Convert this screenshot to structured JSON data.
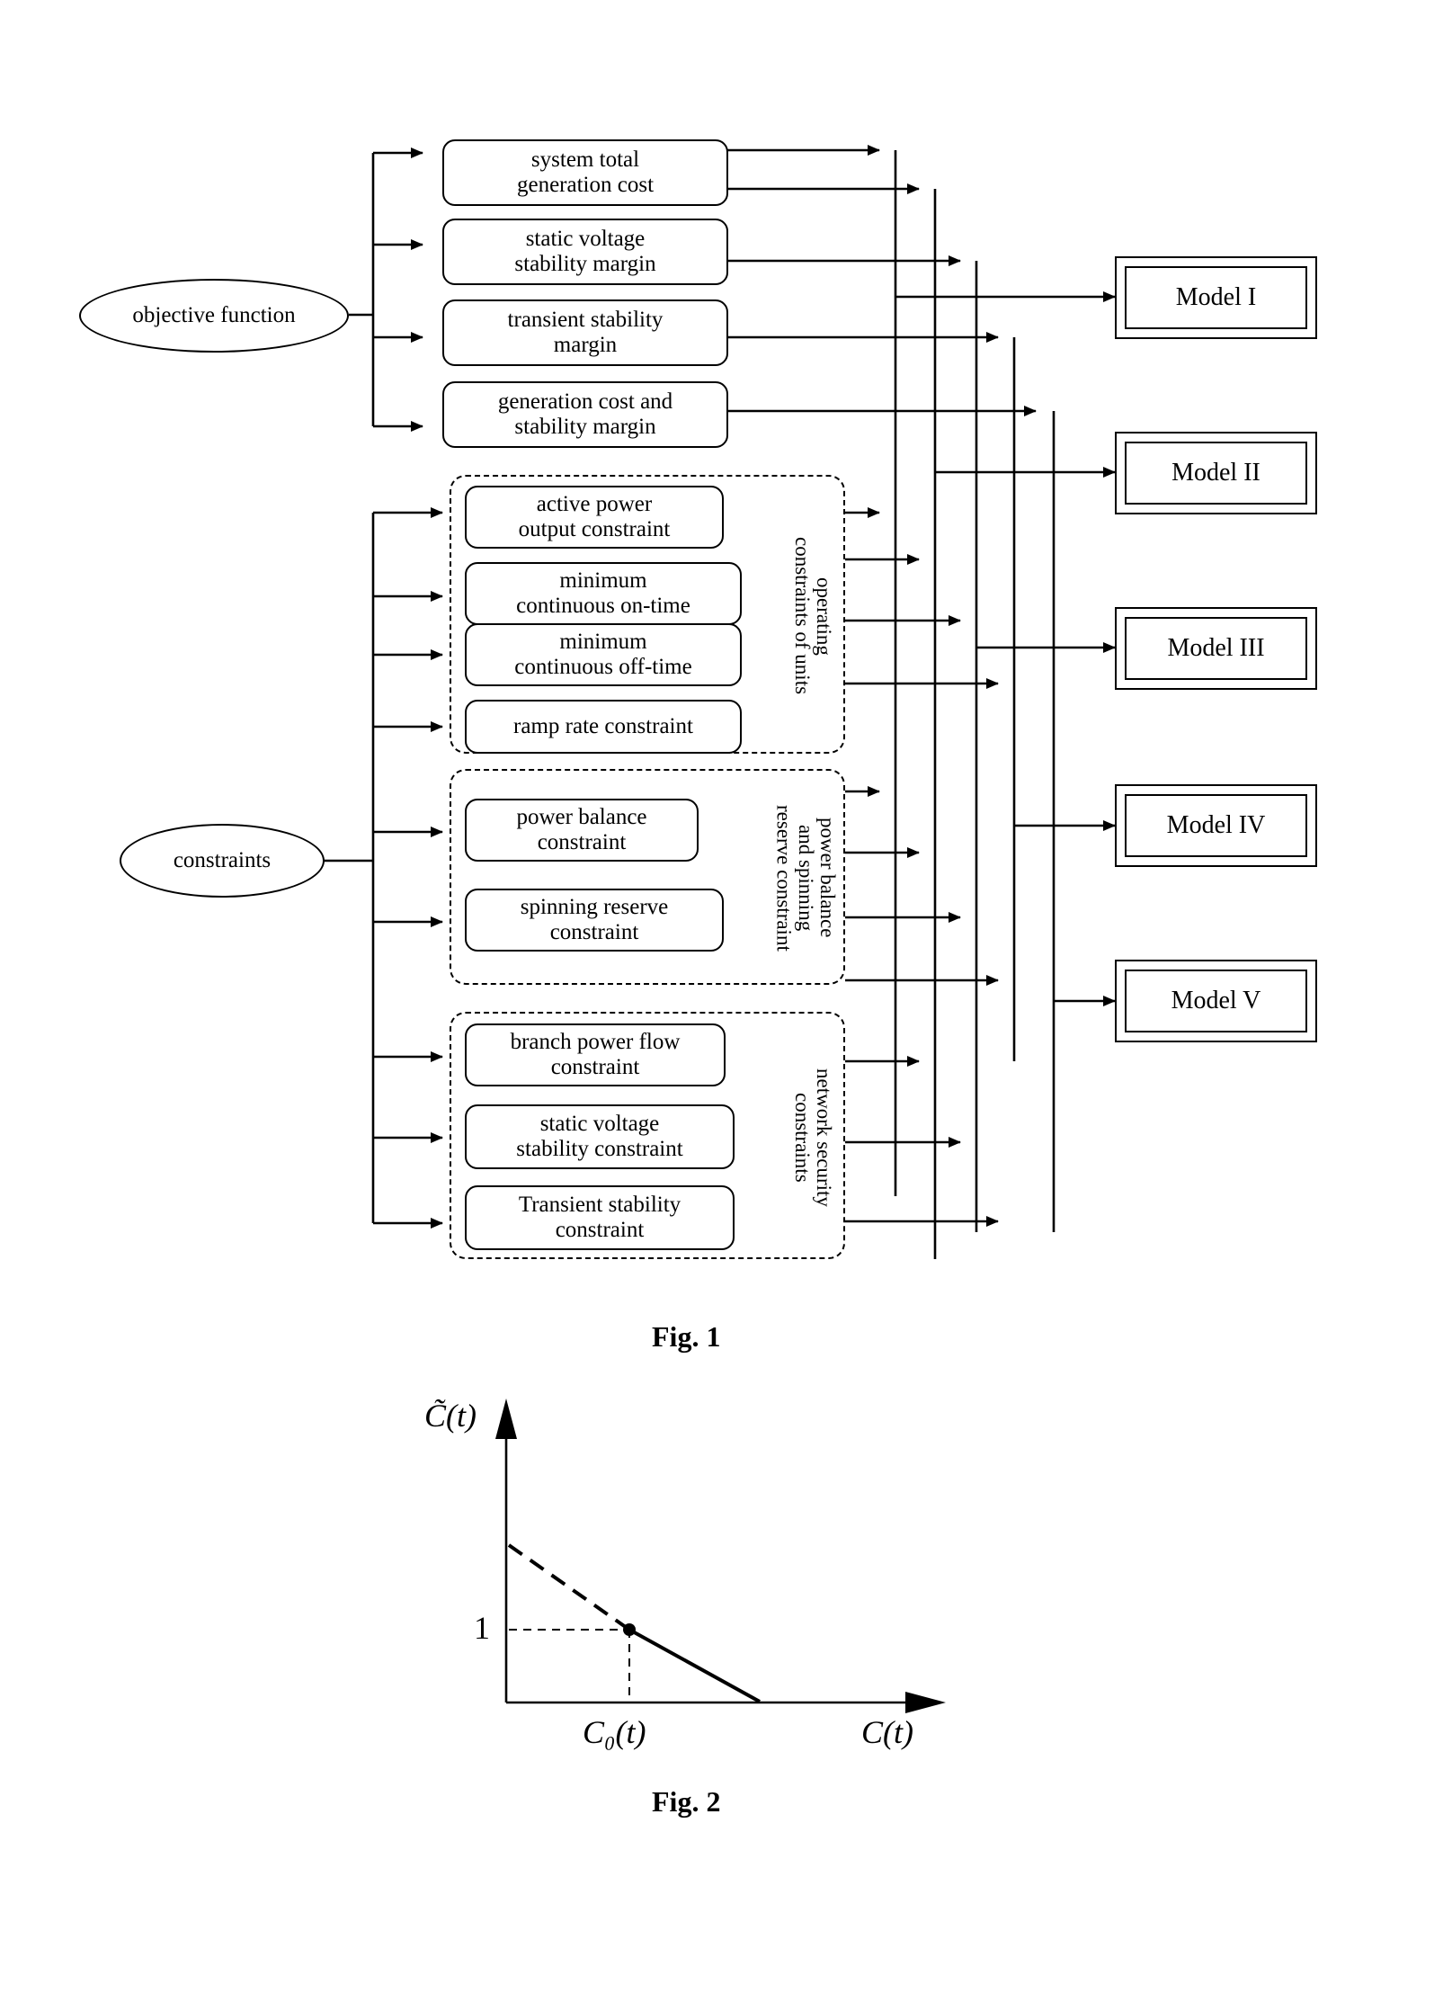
{
  "figure1": {
    "caption": "Fig. 1",
    "roots": [
      {
        "id": "objective-function",
        "label": "objective function"
      },
      {
        "id": "constraints",
        "label": "constraints"
      }
    ],
    "objective_items": [
      {
        "id": "system-total-generation-cost",
        "label": "system total\ngeneration cost"
      },
      {
        "id": "static-voltage-stability-margin",
        "label": "static voltage\nstability margin"
      },
      {
        "id": "transient-stability-margin",
        "label": "transient stability\nmargin"
      },
      {
        "id": "generation-cost-and-stability-margin",
        "label": "generation cost and\nstability margin"
      }
    ],
    "constraint_groups": [
      {
        "id": "operating-constraints-of-units",
        "vertical_label": "operating\nconstraints of units",
        "items": [
          {
            "id": "active-power-output-constraint",
            "label": "active power\noutput constraint"
          },
          {
            "id": "minimum-continuous-on-time",
            "label": "minimum\ncontinuous on-time"
          },
          {
            "id": "minimum-continuous-off-time",
            "label": "minimum\ncontinuous off-time"
          },
          {
            "id": "ramp-rate-constraint",
            "label": "ramp rate constraint"
          }
        ]
      },
      {
        "id": "power-balance-and-spinning-reserve-constraint",
        "vertical_label": "power balance\nand spinning\nreserve constraint",
        "items": [
          {
            "id": "power-balance-constraint",
            "label": "power balance\nconstraint"
          },
          {
            "id": "spinning-reserve-constraint",
            "label": "spinning reserve\nconstraint"
          }
        ]
      },
      {
        "id": "network-security-constraints",
        "vertical_label": "network security\nconstraints",
        "items": [
          {
            "id": "branch-power-flow-constraint",
            "label": "branch power flow\nconstraint"
          },
          {
            "id": "static-voltage-stability-constraint",
            "label": "static voltage\nstability constraint"
          },
          {
            "id": "transient-stability-constraint",
            "label": "Transient stability\nconstraint"
          }
        ]
      }
    ],
    "models": [
      {
        "id": "model-1",
        "label": "Model I"
      },
      {
        "id": "model-2",
        "label": "Model II"
      },
      {
        "id": "model-3",
        "label": "Model III"
      },
      {
        "id": "model-4",
        "label": "Model IV"
      },
      {
        "id": "model-5",
        "label": "Model V"
      }
    ]
  },
  "figure2": {
    "caption": "Fig. 2",
    "y_axis_label": "C̃(t)",
    "x_axis_label": "C(t)",
    "tick_y": "1",
    "tick_x": "C₀(t)"
  },
  "chart_data": {
    "type": "line",
    "title": "",
    "xlabel": "C(t)",
    "ylabel": "C̃(t)",
    "annotations": [
      {
        "text": "1",
        "axis": "y",
        "value": 1
      },
      {
        "text": "C₀(t)",
        "axis": "x",
        "value": 0.38
      }
    ],
    "series": [
      {
        "name": "extrapolated-segment",
        "style": "dashed",
        "x": [
          0.0,
          0.38
        ],
        "y": [
          2.2,
          1.0
        ]
      },
      {
        "name": "membership-function",
        "style": "solid",
        "x": [
          0.38,
          0.92
        ],
        "y": [
          1.0,
          0.0
        ]
      }
    ],
    "marker_points": [
      {
        "x": 0.38,
        "y": 1.0
      }
    ],
    "guides": [
      {
        "type": "horizontal-dashed",
        "y": 1.0,
        "from_x": 0.0,
        "to_x": 0.38
      },
      {
        "type": "vertical-dashed",
        "x": 0.38,
        "from_y": 0.0,
        "to_y": 1.0
      }
    ],
    "xlim": [
      0,
      1.15
    ],
    "ylim": [
      0,
      2.6
    ],
    "grid": false,
    "legend": "none"
  }
}
